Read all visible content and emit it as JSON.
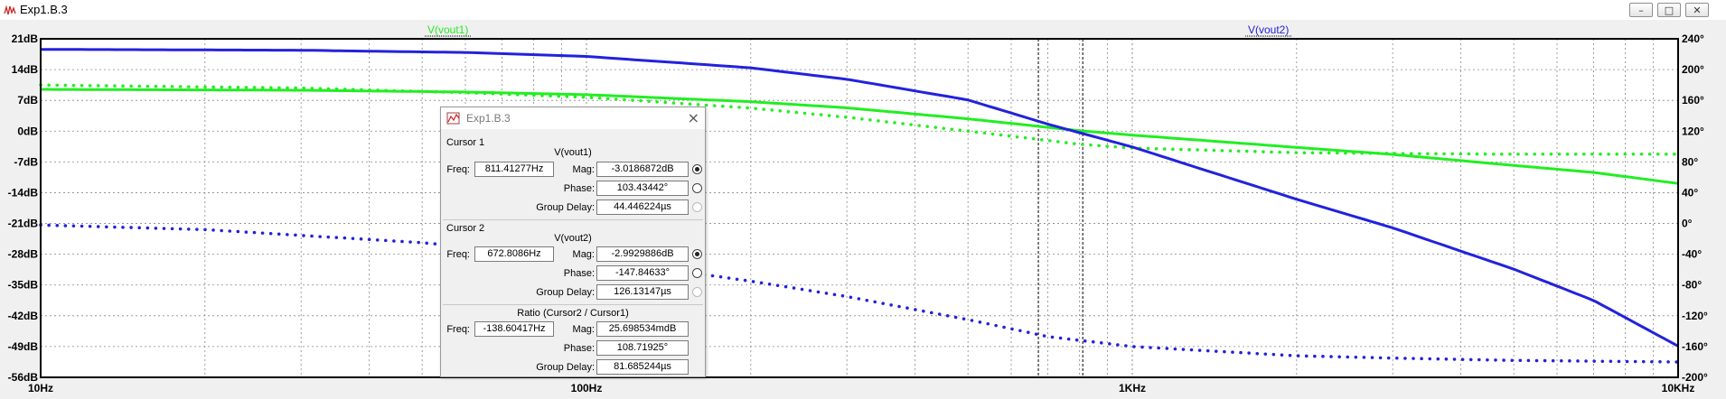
{
  "window": {
    "title": "Exp1.B.3",
    "buttons": {
      "minimize": "–",
      "maximize": "□",
      "close": "✕"
    }
  },
  "chart_data": {
    "type": "line",
    "x_scale": "log",
    "xlim": [
      10,
      10000
    ],
    "x_ticks": [
      "10Hz",
      "100Hz",
      "1KHz",
      "10KHz"
    ],
    "y_left_ticks": [
      "21dB",
      "14dB",
      "7dB",
      "0dB",
      "-7dB",
      "-14dB",
      "-21dB",
      "-28dB",
      "-35dB",
      "-42dB",
      "-49dB",
      "-56dB"
    ],
    "y_left_range": [
      -56,
      21
    ],
    "y_right_ticks": [
      "240°",
      "200°",
      "160°",
      "120°",
      "80°",
      "40°",
      "0°",
      "-40°",
      "-80°",
      "-120°",
      "-160°",
      "-200°"
    ],
    "y_right_range": [
      -200,
      240
    ],
    "grid": true,
    "series": [
      {
        "name": "V(vout1)",
        "color": "#22ee22",
        "magnitude_db": {
          "x": [
            10,
            30,
            60,
            100,
            200,
            300,
            500,
            800,
            1000,
            2000,
            3000,
            5000,
            7000,
            10000
          ],
          "y": [
            9.5,
            9.3,
            8.9,
            8.3,
            6.7,
            5.3,
            2.8,
            0.1,
            -0.9,
            -3.7,
            -5.3,
            -7.8,
            -9.4,
            -11.9
          ]
        },
        "phase_deg": {
          "x": [
            10,
            30,
            60,
            100,
            200,
            300,
            500,
            800,
            1000,
            2000,
            3000,
            5000,
            10000
          ],
          "y": [
            180,
            176,
            170,
            164,
            150,
            138,
            120,
            103,
            98,
            92,
            91,
            90,
            90
          ]
        }
      },
      {
        "name": "V(vout2)",
        "color": "#2222dd",
        "magnitude_db": {
          "x": [
            10,
            30,
            60,
            100,
            200,
            300,
            500,
            700,
            1000,
            2000,
            3000,
            5000,
            7000,
            10000
          ],
          "y": [
            18.6,
            18.4,
            17.9,
            17,
            14.4,
            11.8,
            7.1,
            1.6,
            -3.6,
            -15.5,
            -22,
            -31.4,
            -38.5,
            -48.9
          ]
        },
        "phase_deg": {
          "x": [
            10,
            20,
            50,
            100,
            200,
            300,
            500,
            700,
            1000,
            2000,
            3000,
            5000,
            10000
          ],
          "y": [
            -2,
            -8,
            -25,
            -45,
            -75,
            -95,
            -125,
            -147,
            -160,
            -172,
            -175,
            -178,
            -180
          ]
        }
      }
    ],
    "cursors": [
      {
        "freq_hz": 811.41277
      },
      {
        "freq_hz": 672.8086
      }
    ],
    "cursor_dialog": {
      "title": "Exp1.B.3",
      "cursor1": {
        "heading": "Cursor 1",
        "trace": "V(vout1)",
        "freq_label": "Freq:",
        "freq": "811.41277Hz",
        "mag_label": "Mag:",
        "mag": "-3.0186872dB",
        "phase_label": "Phase:",
        "phase": "103.43442°",
        "gd_label": "Group Delay:",
        "group_delay": "44.446224µs"
      },
      "cursor2": {
        "heading": "Cursor 2",
        "trace": "V(vout2)",
        "freq_label": "Freq:",
        "freq": "672.8086Hz",
        "mag_label": "Mag:",
        "mag": "-2.9929886dB",
        "phase_label": "Phase:",
        "phase": "-147.84633°",
        "gd_label": "Group Delay:",
        "group_delay": "126.13147µs"
      },
      "ratio": {
        "heading": "Ratio (Cursor2 / Cursor1)",
        "freq_label": "Freq:",
        "freq": "-138.60417Hz",
        "mag_label": "Mag:",
        "mag": "25.698534mdB",
        "phase_label": "Phase:",
        "phase": "108.71925°",
        "gd_label": "Group Delay:",
        "group_delay": "81.685244µs"
      }
    }
  }
}
